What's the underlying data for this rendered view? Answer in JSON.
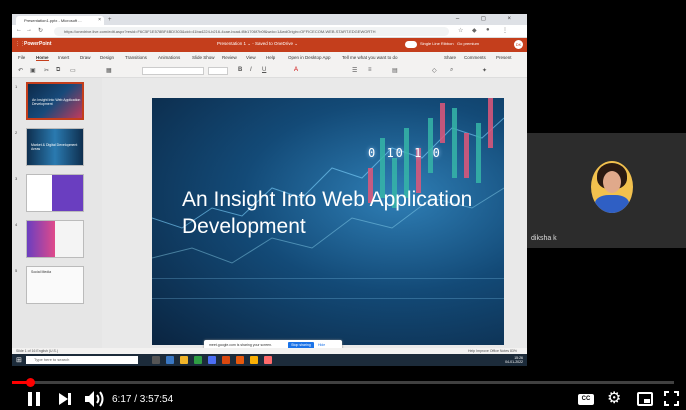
{
  "browser": {
    "tab_title": "Presentation1.pptx - Microsoft ...",
    "tab_close": "×",
    "new_tab": "+",
    "window_controls": "– ◻ ×",
    "url": "https://onedrive.live.com/edit.aspx?resid=F6C5F1E578BF4BD!303&cid=41ba4224-b216-4cae-bcad-f8b1706f7b0f&wdo=1&wdOrigin=OFFICECOM-WEB.START.EDGEWORTH"
  },
  "office": {
    "app_name": "PowerPoint",
    "doc_title": "Presentation 1 ⌄ - Saved to OneDrive ⌄",
    "toggle_label": "Single Line Ribbon",
    "premium_label": "Go premium",
    "menu": [
      "File",
      "Home",
      "Insert",
      "Draw",
      "Design",
      "Transitions",
      "Animations",
      "Slide Show",
      "Review",
      "View",
      "Help",
      "Open in Desktop App",
      "Tell me what you want to do",
      "Share",
      "Comments",
      "Present"
    ],
    "active_menu": "Home"
  },
  "slide": {
    "title": "An Insight Into Web Application Development",
    "digits": "0 10 1 0"
  },
  "thumbnails": [
    {
      "num": "1",
      "caption": "An Insight Into Web Application Development"
    },
    {
      "num": "2",
      "caption": "Market & Digital Development Areas"
    },
    {
      "num": "3",
      "caption": ""
    },
    {
      "num": "4",
      "caption": ""
    },
    {
      "num": "5",
      "caption": "Social Media"
    }
  ],
  "share_bar": {
    "text": "meet.google.com is sharing your screen.",
    "stop_label": "Stop sharing",
    "hide_label": "Hide"
  },
  "statusbar": {
    "left": "Slide 1 of 16    English (U.S.)",
    "right": "Help Improve Office    Notes    83%"
  },
  "taskbar": {
    "search_placeholder": "Type here to search",
    "clock": "15:26",
    "date": "04-01-2022"
  },
  "participant": {
    "name": "diksha k"
  },
  "player": {
    "time": "6:17 / 3:57:54",
    "progress_fraction": 0.0273,
    "cc_label": "CC",
    "settings_glyph": "⚙",
    "accent_color": "#ff0000"
  }
}
